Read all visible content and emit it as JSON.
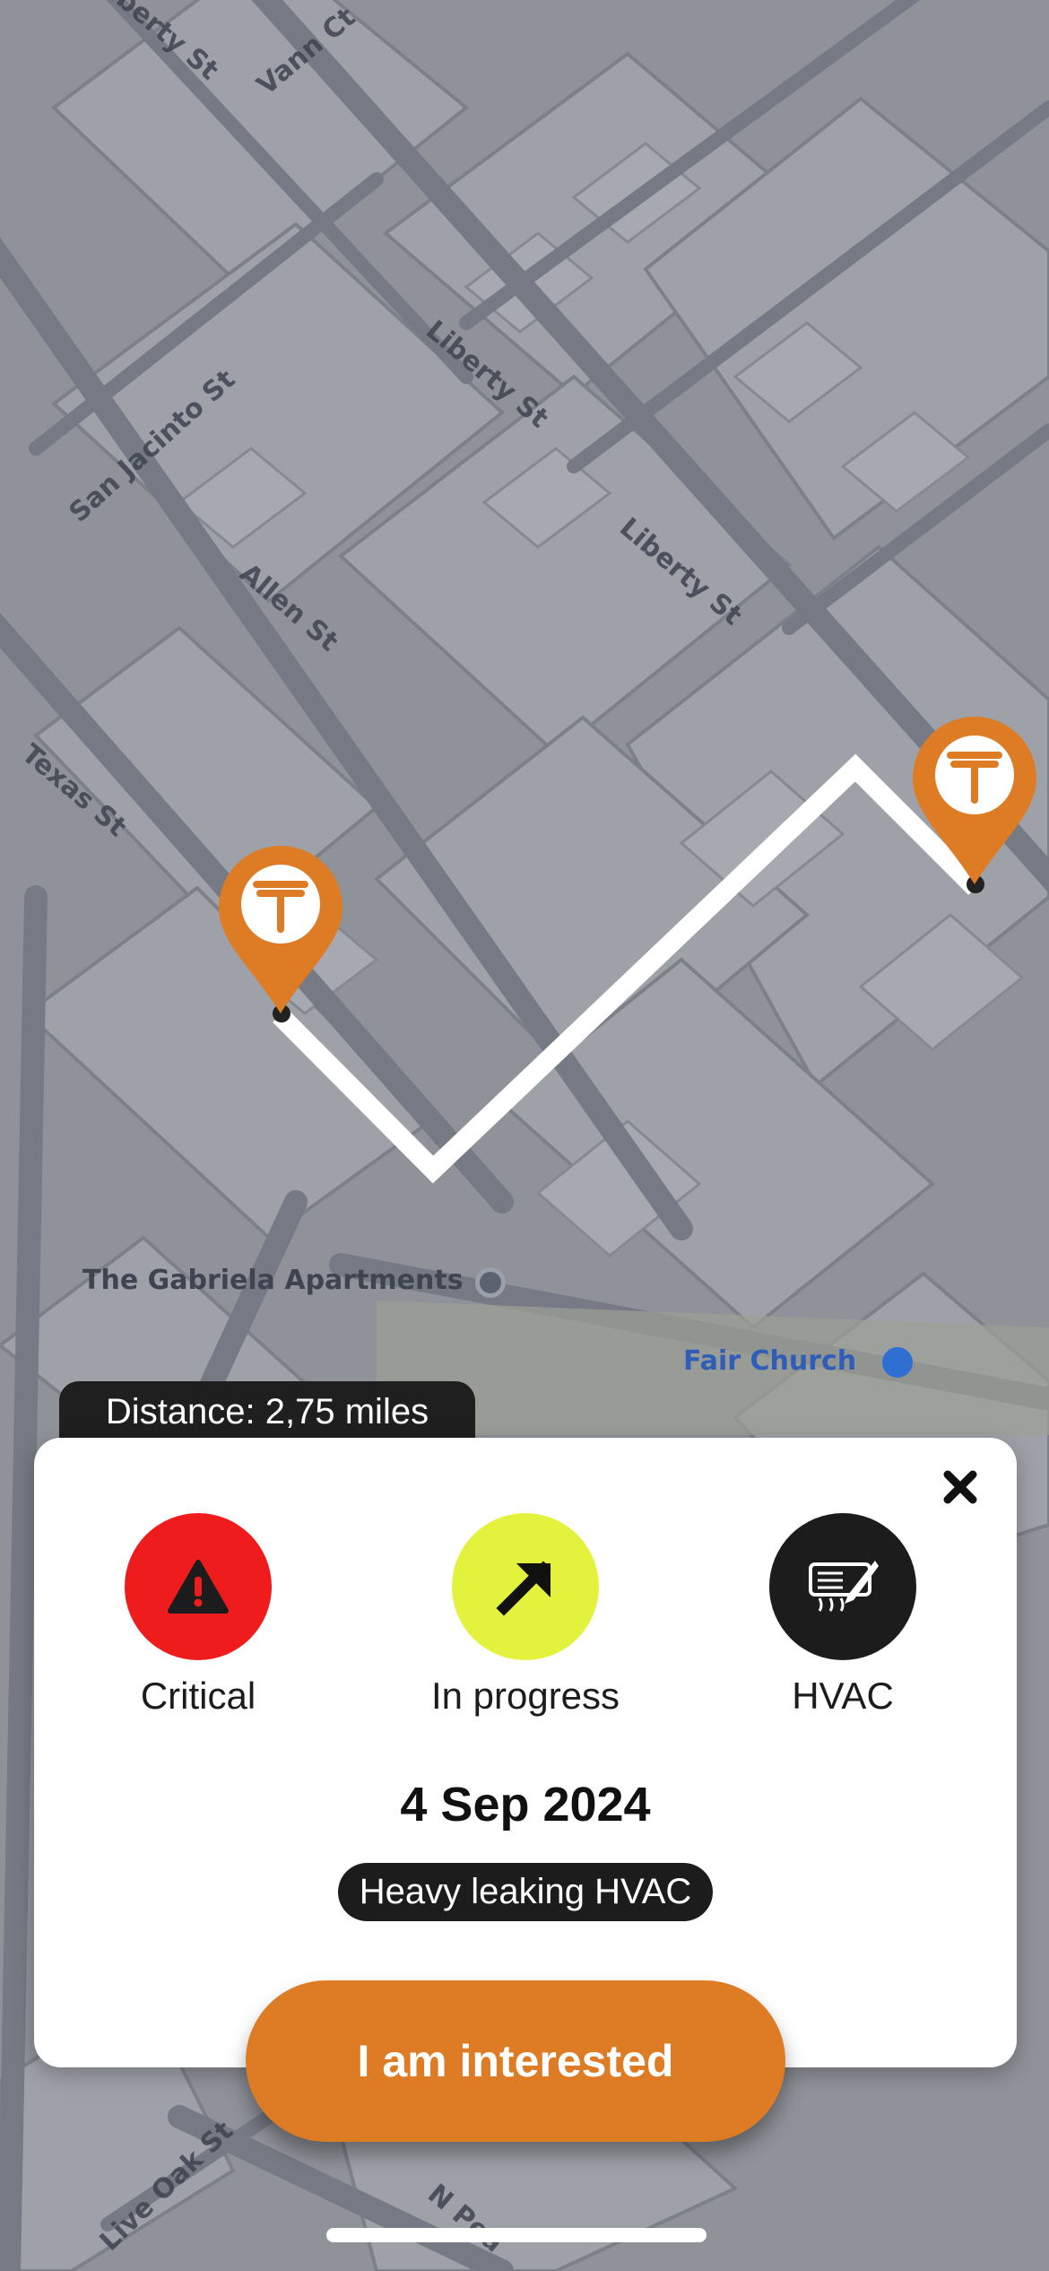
{
  "map": {
    "street_labels": [
      "Liberty St",
      "Vann Ct",
      "San Jacinto St",
      "Liberty St",
      "Liberty St",
      "Allen St",
      "Texas St",
      "Live Oak St",
      "N Pea"
    ],
    "poi": [
      {
        "name": "The Gabriela Apartments",
        "icon": "place-pin-icon"
      },
      {
        "name": "Fair Church",
        "icon": "church-icon"
      }
    ],
    "pin_icon": "t-logo-pin-icon",
    "colors": {
      "pin": "#dd7c24",
      "route": "#ffffff"
    }
  },
  "distance": {
    "text": "Distance: 2,75 miles"
  },
  "card": {
    "close_icon": "close-icon",
    "statuses": [
      {
        "label": "Critical",
        "icon": "warning-icon",
        "color": "#ee1c1c"
      },
      {
        "label": "In progress",
        "icon": "arrow-up-right-icon",
        "color": "#e3f23d"
      },
      {
        "label": "HVAC",
        "icon": "hvac-icon",
        "color": "#1c1c1c"
      }
    ],
    "date": "4 Sep 2024",
    "description": "Heavy leaking HVAC"
  },
  "cta": {
    "label": "I am interested",
    "color": "#dd7c24"
  }
}
